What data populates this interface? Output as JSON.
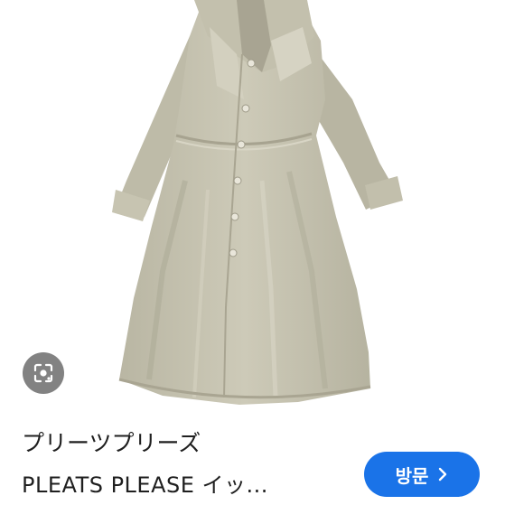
{
  "lens": {
    "icon": "google-lens-icon"
  },
  "result": {
    "title_line1": "プリーツプリーズ",
    "title_line2": "PLEATS PLEASE イッ..."
  },
  "visit_button": {
    "label": "방문",
    "icon": "chevron-right-icon"
  },
  "colors": {
    "accent": "#1a73e8",
    "coat": "#c9c6b4",
    "text": "#1f1f1f"
  }
}
